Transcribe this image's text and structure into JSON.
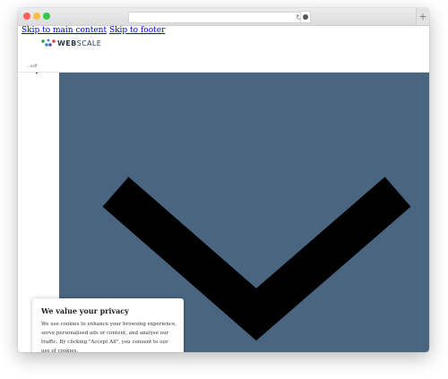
{
  "browser": {
    "url": "",
    "reload_icon": "reload-icon",
    "new_tab": "+"
  },
  "skip_links": {
    "main": "Skip to main content",
    "footer": "Skip to footer"
  },
  "logo": {
    "brand_bold": "WEB",
    "brand_rest": "SCALE",
    "colors": [
      "#2e9b4a",
      "#2a8fc4",
      "#6b4aa8",
      "#e0463a"
    ]
  },
  "nav": {
    "label": "...noff"
  },
  "hero": {
    "background": "#4a6580",
    "icon": "chevron-down-icon"
  },
  "cookie": {
    "title": "We value your privacy",
    "text": "We use cookies to enhance your browsing experience, serve personalised ads or content, and analyse our traffic. By clicking \"Accept All\", you consent to our use of cookies."
  }
}
